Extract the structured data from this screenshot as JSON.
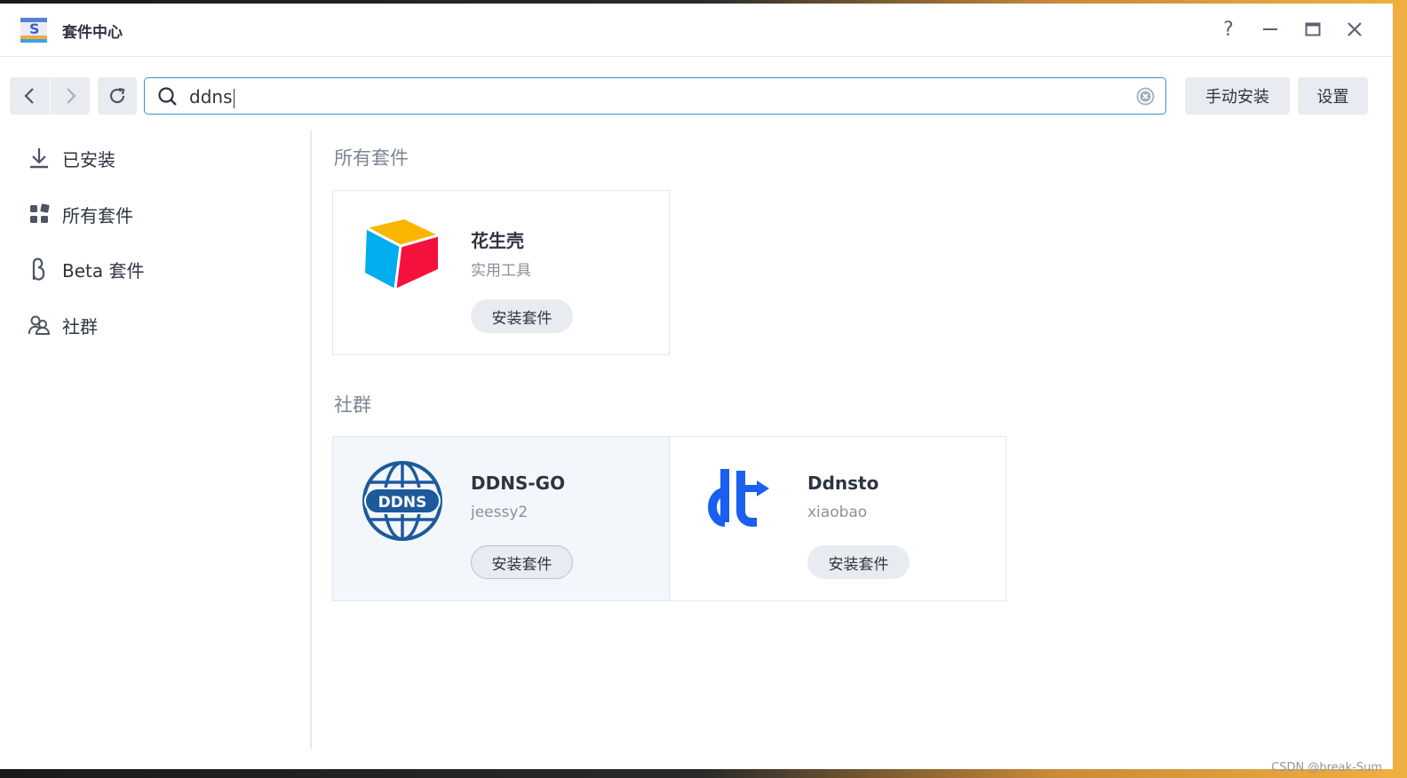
{
  "window": {
    "title": "套件中心"
  },
  "toolbar": {
    "search_value": "ddns",
    "manual_install_label": "手动安装",
    "settings_label": "设置"
  },
  "sidebar": {
    "items": [
      {
        "label": "已安装",
        "icon": "download-icon"
      },
      {
        "label": "所有套件",
        "icon": "grid-icon"
      },
      {
        "label": "Beta 套件",
        "icon": "beta-icon"
      },
      {
        "label": "社群",
        "icon": "community-icon"
      }
    ]
  },
  "sections": [
    {
      "title": "所有套件",
      "cards": [
        {
          "name": "花生壳",
          "subtitle": "实用工具",
          "button": "安装套件",
          "icon": "oray-cube-logo"
        }
      ]
    },
    {
      "title": "社群",
      "cards": [
        {
          "name": "DDNS-GO",
          "subtitle": "jeessy2",
          "button": "安装套件",
          "icon": "ddns-globe-logo"
        },
        {
          "name": "Ddnsto",
          "subtitle": "xiaobao",
          "button": "安装套件",
          "icon": "ddnsto-dt-logo"
        }
      ]
    }
  ],
  "watermark": "CSDN @break-Sum",
  "colors": {
    "accent": "#3b8fd9",
    "button_bg": "#e8ecf1",
    "text": "#2e3440",
    "muted": "#8a919c",
    "ddnsto_blue": "#1a5ff0",
    "ddns_blue": "#1d5a9c"
  }
}
